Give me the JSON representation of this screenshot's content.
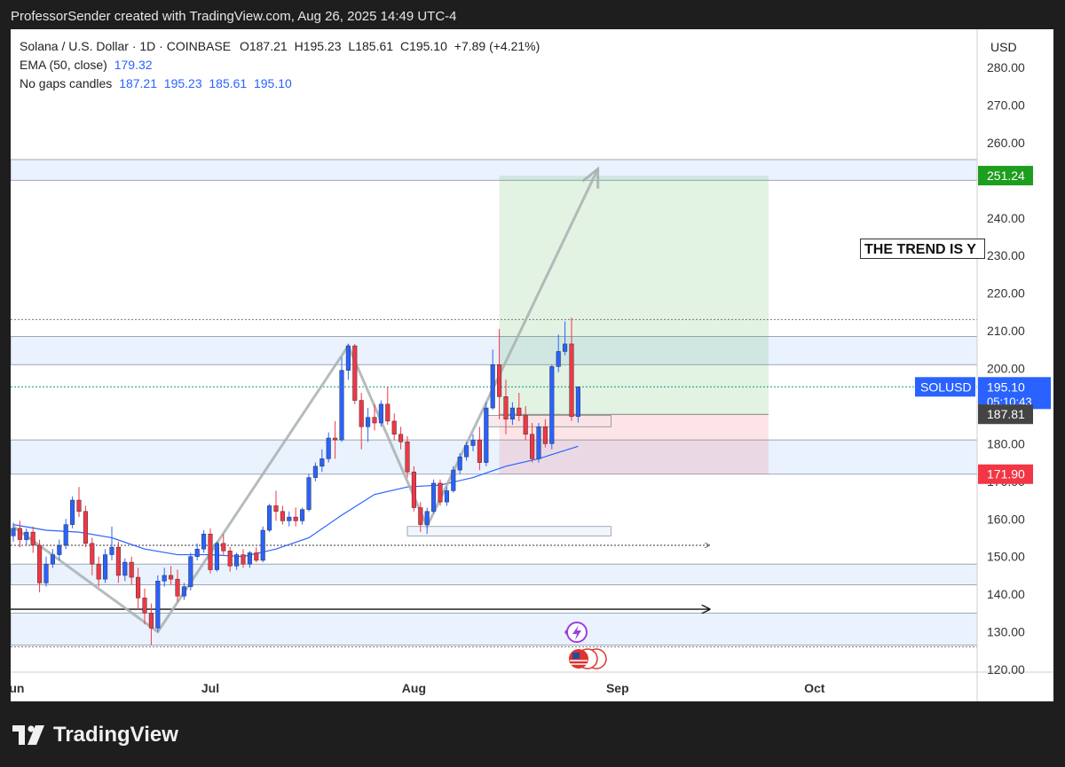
{
  "header": {
    "text": "ProfessorSender created with TradingView.com, Aug 26, 2025 14:49 UTC-4"
  },
  "legend": {
    "symbol": "Solana / U.S. Dollar · 1D · COINBASE",
    "o_label": "O",
    "o": "187.21",
    "h_label": "H",
    "h": "195.23",
    "l_label": "L",
    "l": "185.61",
    "c_label": "C",
    "c": "195.10",
    "change": "+7.89 (+4.21%)",
    "ema_label": "EMA (50, close)",
    "ema_value": "179.32",
    "candles_label": "No gaps candles",
    "candles_values": "187.21  195.23  185.61  195.10"
  },
  "currency": "USD",
  "annotation": "THE TREND IS Y",
  "brand": {
    "name": "TradingView"
  },
  "colors": {
    "up": "#2962ff",
    "down": "#f23645",
    "ema": "#2962ff",
    "target": "#089981",
    "stop": "#f23645",
    "zone": "#e3eefc"
  },
  "chart_data": {
    "type": "candlestick",
    "symbol": "SOLUSD",
    "y_ticks": [
      "120.00",
      "130.00",
      "140.00",
      "150.00",
      "160.00",
      "170.00",
      "180.00",
      "190.00",
      "200.00",
      "210.00",
      "220.00",
      "230.00",
      "240.00",
      "250.00",
      "260.00",
      "270.00",
      "280.00"
    ],
    "y_tick_values": [
      120,
      130,
      140,
      150,
      160,
      170,
      180,
      190,
      200,
      210,
      220,
      230,
      240,
      250,
      260,
      270,
      280
    ],
    "ylim": [
      120,
      282
    ],
    "x_ticks": [
      {
        "label": "Jun",
        "date": "2025-06-01"
      },
      {
        "label": "Jul",
        "date": "2025-07-01"
      },
      {
        "label": "Aug",
        "date": "2025-08-01"
      },
      {
        "label": "Sep",
        "date": "2025-09-01"
      },
      {
        "label": "Oct",
        "date": "2025-10-01"
      }
    ],
    "xlim": [
      "2025-06-01",
      "2025-10-20"
    ],
    "price_labels": [
      {
        "label": "251.24",
        "value": 251.24,
        "color": "#1e9e1e"
      },
      {
        "label": "195.10",
        "sub": "05:10:43",
        "tag": "SOLUSD",
        "value": 195.1,
        "color": "#2962ff"
      },
      {
        "label": "187.81",
        "value": 187.81,
        "color": "#444444"
      },
      {
        "label": "171.90",
        "value": 171.9,
        "color": "#f23645"
      }
    ],
    "candles": [
      {
        "date": "2025-06-01",
        "o": 155.5,
        "h": 159.0,
        "l": 154.0,
        "c": 157.5
      },
      {
        "date": "2025-06-02",
        "o": 157.5,
        "h": 159.5,
        "l": 152.5,
        "c": 154.5
      },
      {
        "date": "2025-06-03",
        "o": 154.5,
        "h": 157.5,
        "l": 153.0,
        "c": 156.5
      },
      {
        "date": "2025-06-04",
        "o": 156.5,
        "h": 158.0,
        "l": 151.0,
        "c": 153.0
      },
      {
        "date": "2025-06-05",
        "o": 153.0,
        "h": 154.5,
        "l": 140.5,
        "c": 143.0
      },
      {
        "date": "2025-06-06",
        "o": 143.0,
        "h": 150.0,
        "l": 142.0,
        "c": 148.0
      },
      {
        "date": "2025-06-07",
        "o": 148.0,
        "h": 152.0,
        "l": 147.0,
        "c": 150.5
      },
      {
        "date": "2025-06-08",
        "o": 150.5,
        "h": 154.5,
        "l": 149.0,
        "c": 153.0
      },
      {
        "date": "2025-06-09",
        "o": 153.0,
        "h": 160.0,
        "l": 152.0,
        "c": 158.5
      },
      {
        "date": "2025-06-10",
        "o": 158.5,
        "h": 166.0,
        "l": 157.5,
        "c": 165.0
      },
      {
        "date": "2025-06-11",
        "o": 165.0,
        "h": 168.5,
        "l": 160.5,
        "c": 162.0
      },
      {
        "date": "2025-06-12",
        "o": 162.0,
        "h": 163.5,
        "l": 152.5,
        "c": 153.5
      },
      {
        "date": "2025-06-13",
        "o": 153.5,
        "h": 155.0,
        "l": 145.0,
        "c": 148.0
      },
      {
        "date": "2025-06-14",
        "o": 148.0,
        "h": 150.0,
        "l": 142.0,
        "c": 144.0
      },
      {
        "date": "2025-06-15",
        "o": 144.0,
        "h": 152.0,
        "l": 143.0,
        "c": 150.5
      },
      {
        "date": "2025-06-16",
        "o": 150.5,
        "h": 158.0,
        "l": 149.0,
        "c": 152.5
      },
      {
        "date": "2025-06-17",
        "o": 152.5,
        "h": 154.0,
        "l": 143.0,
        "c": 145.0
      },
      {
        "date": "2025-06-18",
        "o": 145.0,
        "h": 149.5,
        "l": 143.5,
        "c": 148.5
      },
      {
        "date": "2025-06-19",
        "o": 148.5,
        "h": 150.0,
        "l": 142.5,
        "c": 144.5
      },
      {
        "date": "2025-06-20",
        "o": 144.5,
        "h": 147.0,
        "l": 136.0,
        "c": 139.0
      },
      {
        "date": "2025-06-21",
        "o": 139.0,
        "h": 141.5,
        "l": 132.0,
        "c": 135.0
      },
      {
        "date": "2025-06-22",
        "o": 135.0,
        "h": 137.5,
        "l": 126.5,
        "c": 131.0
      },
      {
        "date": "2025-06-23",
        "o": 131.0,
        "h": 145.0,
        "l": 130.0,
        "c": 143.5
      },
      {
        "date": "2025-06-24",
        "o": 143.5,
        "h": 147.0,
        "l": 142.0,
        "c": 145.0
      },
      {
        "date": "2025-06-25",
        "o": 145.0,
        "h": 147.5,
        "l": 142.5,
        "c": 144.0
      },
      {
        "date": "2025-06-26",
        "o": 144.0,
        "h": 146.5,
        "l": 138.0,
        "c": 139.5
      },
      {
        "date": "2025-06-27",
        "o": 139.5,
        "h": 143.0,
        "l": 138.5,
        "c": 142.0
      },
      {
        "date": "2025-06-28",
        "o": 142.0,
        "h": 151.0,
        "l": 141.0,
        "c": 150.0
      },
      {
        "date": "2025-06-29",
        "o": 150.0,
        "h": 153.5,
        "l": 149.0,
        "c": 152.0
      },
      {
        "date": "2025-06-30",
        "o": 152.0,
        "h": 157.0,
        "l": 151.0,
        "c": 156.0
      },
      {
        "date": "2025-07-01",
        "o": 156.0,
        "h": 157.5,
        "l": 145.5,
        "c": 146.5
      },
      {
        "date": "2025-07-02",
        "o": 146.5,
        "h": 154.0,
        "l": 146.0,
        "c": 153.5
      },
      {
        "date": "2025-07-03",
        "o": 153.5,
        "h": 156.0,
        "l": 150.5,
        "c": 151.5
      },
      {
        "date": "2025-07-04",
        "o": 151.5,
        "h": 152.5,
        "l": 146.0,
        "c": 147.5
      },
      {
        "date": "2025-07-05",
        "o": 147.5,
        "h": 151.0,
        "l": 146.5,
        "c": 150.5
      },
      {
        "date": "2025-07-06",
        "o": 150.5,
        "h": 152.0,
        "l": 147.0,
        "c": 148.0
      },
      {
        "date": "2025-07-07",
        "o": 148.0,
        "h": 151.5,
        "l": 147.0,
        "c": 151.0
      },
      {
        "date": "2025-07-08",
        "o": 151.0,
        "h": 152.5,
        "l": 148.5,
        "c": 149.0
      },
      {
        "date": "2025-07-09",
        "o": 149.0,
        "h": 158.0,
        "l": 148.5,
        "c": 157.0
      },
      {
        "date": "2025-07-10",
        "o": 157.0,
        "h": 164.0,
        "l": 156.5,
        "c": 163.5
      },
      {
        "date": "2025-07-11",
        "o": 163.5,
        "h": 167.5,
        "l": 159.5,
        "c": 162.0
      },
      {
        "date": "2025-07-12",
        "o": 162.0,
        "h": 163.5,
        "l": 158.5,
        "c": 159.5
      },
      {
        "date": "2025-07-13",
        "o": 159.5,
        "h": 162.0,
        "l": 158.0,
        "c": 160.5
      },
      {
        "date": "2025-07-14",
        "o": 160.5,
        "h": 163.0,
        "l": 158.0,
        "c": 159.5
      },
      {
        "date": "2025-07-15",
        "o": 159.5,
        "h": 163.0,
        "l": 158.5,
        "c": 162.5
      },
      {
        "date": "2025-07-16",
        "o": 162.5,
        "h": 172.0,
        "l": 162.0,
        "c": 171.0
      },
      {
        "date": "2025-07-17",
        "o": 171.0,
        "h": 175.0,
        "l": 170.0,
        "c": 174.0
      },
      {
        "date": "2025-07-18",
        "o": 174.0,
        "h": 178.5,
        "l": 172.5,
        "c": 176.0
      },
      {
        "date": "2025-07-19",
        "o": 176.0,
        "h": 183.0,
        "l": 175.0,
        "c": 181.5
      },
      {
        "date": "2025-07-20",
        "o": 181.5,
        "h": 186.0,
        "l": 176.0,
        "c": 181.0
      },
      {
        "date": "2025-07-21",
        "o": 181.0,
        "h": 203.0,
        "l": 180.5,
        "c": 199.5
      },
      {
        "date": "2025-07-22",
        "o": 199.5,
        "h": 206.5,
        "l": 197.0,
        "c": 206.0
      },
      {
        "date": "2025-07-23",
        "o": 206.0,
        "h": 206.5,
        "l": 190.5,
        "c": 191.5
      },
      {
        "date": "2025-07-24",
        "o": 191.5,
        "h": 193.5,
        "l": 178.5,
        "c": 184.5
      },
      {
        "date": "2025-07-25",
        "o": 184.5,
        "h": 189.5,
        "l": 180.5,
        "c": 187.0
      },
      {
        "date": "2025-07-26",
        "o": 187.0,
        "h": 190.5,
        "l": 183.5,
        "c": 185.5
      },
      {
        "date": "2025-07-27",
        "o": 185.5,
        "h": 191.5,
        "l": 184.5,
        "c": 190.5
      },
      {
        "date": "2025-07-28",
        "o": 190.5,
        "h": 195.0,
        "l": 185.0,
        "c": 186.0
      },
      {
        "date": "2025-07-29",
        "o": 186.0,
        "h": 188.0,
        "l": 181.0,
        "c": 182.5
      },
      {
        "date": "2025-07-30",
        "o": 182.5,
        "h": 184.5,
        "l": 178.5,
        "c": 180.5
      },
      {
        "date": "2025-07-31",
        "o": 180.5,
        "h": 182.0,
        "l": 171.0,
        "c": 172.5
      },
      {
        "date": "2025-08-01",
        "o": 172.5,
        "h": 174.0,
        "l": 162.0,
        "c": 163.0
      },
      {
        "date": "2025-08-02",
        "o": 163.0,
        "h": 164.5,
        "l": 156.5,
        "c": 158.5
      },
      {
        "date": "2025-08-03",
        "o": 158.5,
        "h": 163.0,
        "l": 156.0,
        "c": 162.0
      },
      {
        "date": "2025-08-04",
        "o": 162.0,
        "h": 170.5,
        "l": 161.5,
        "c": 169.5
      },
      {
        "date": "2025-08-05",
        "o": 169.5,
        "h": 170.5,
        "l": 163.5,
        "c": 164.5
      },
      {
        "date": "2025-08-06",
        "o": 164.5,
        "h": 168.5,
        "l": 163.5,
        "c": 167.5
      },
      {
        "date": "2025-08-07",
        "o": 167.5,
        "h": 174.0,
        "l": 167.0,
        "c": 173.0
      },
      {
        "date": "2025-08-08",
        "o": 173.0,
        "h": 177.5,
        "l": 172.0,
        "c": 176.5
      },
      {
        "date": "2025-08-09",
        "o": 176.5,
        "h": 180.5,
        "l": 175.5,
        "c": 179.5
      },
      {
        "date": "2025-08-10",
        "o": 179.5,
        "h": 182.5,
        "l": 178.0,
        "c": 181.0
      },
      {
        "date": "2025-08-11",
        "o": 181.0,
        "h": 184.5,
        "l": 173.0,
        "c": 175.0
      },
      {
        "date": "2025-08-12",
        "o": 175.0,
        "h": 191.0,
        "l": 174.0,
        "c": 189.5
      },
      {
        "date": "2025-08-13",
        "o": 189.5,
        "h": 205.0,
        "l": 189.0,
        "c": 201.0
      },
      {
        "date": "2025-08-14",
        "o": 201.0,
        "h": 210.5,
        "l": 186.5,
        "c": 192.5
      },
      {
        "date": "2025-08-15",
        "o": 192.5,
        "h": 197.0,
        "l": 182.5,
        "c": 186.5
      },
      {
        "date": "2025-08-16",
        "o": 186.5,
        "h": 191.0,
        "l": 185.0,
        "c": 189.5
      },
      {
        "date": "2025-08-17",
        "o": 189.5,
        "h": 193.5,
        "l": 186.0,
        "c": 187.5
      },
      {
        "date": "2025-08-18",
        "o": 187.5,
        "h": 190.0,
        "l": 181.0,
        "c": 182.5
      },
      {
        "date": "2025-08-19",
        "o": 182.5,
        "h": 185.5,
        "l": 175.0,
        "c": 176.0
      },
      {
        "date": "2025-08-20",
        "o": 176.0,
        "h": 185.5,
        "l": 175.0,
        "c": 184.5
      },
      {
        "date": "2025-08-21",
        "o": 184.5,
        "h": 186.5,
        "l": 179.0,
        "c": 180.0
      },
      {
        "date": "2025-08-22",
        "o": 180.0,
        "h": 201.0,
        "l": 178.5,
        "c": 200.5
      },
      {
        "date": "2025-08-23",
        "o": 200.5,
        "h": 209.0,
        "l": 199.0,
        "c": 204.5
      },
      {
        "date": "2025-08-24",
        "o": 204.5,
        "h": 212.5,
        "l": 203.5,
        "c": 206.5
      },
      {
        "date": "2025-08-25",
        "o": 206.5,
        "h": 213.5,
        "l": 186.0,
        "c": 187.2
      },
      {
        "date": "2025-08-26",
        "o": 187.21,
        "h": 195.23,
        "l": 185.61,
        "c": 195.1
      }
    ],
    "ema": [
      {
        "date": "2025-06-01",
        "v": 158.5
      },
      {
        "date": "2025-06-06",
        "v": 157.0
      },
      {
        "date": "2025-06-11",
        "v": 156.5
      },
      {
        "date": "2025-06-16",
        "v": 155.0
      },
      {
        "date": "2025-06-21",
        "v": 152.0
      },
      {
        "date": "2025-06-26",
        "v": 150.5
      },
      {
        "date": "2025-07-01",
        "v": 150.5
      },
      {
        "date": "2025-07-06",
        "v": 150.0
      },
      {
        "date": "2025-07-11",
        "v": 152.0
      },
      {
        "date": "2025-07-16",
        "v": 155.0
      },
      {
        "date": "2025-07-21",
        "v": 161.0
      },
      {
        "date": "2025-07-26",
        "v": 166.5
      },
      {
        "date": "2025-07-31",
        "v": 168.5
      },
      {
        "date": "2025-08-05",
        "v": 169.0
      },
      {
        "date": "2025-08-10",
        "v": 171.0
      },
      {
        "date": "2025-08-15",
        "v": 174.0
      },
      {
        "date": "2025-08-20",
        "v": 176.0
      },
      {
        "date": "2025-08-26",
        "v": 179.32
      }
    ],
    "zones": [
      {
        "low": 250.0,
        "high": 255.5
      },
      {
        "low": 201.0,
        "high": 208.5
      },
      {
        "low": 171.9,
        "high": 181.0
      },
      {
        "low": 155.5,
        "high": 158.0,
        "start": "2025-07-31",
        "end": "2025-08-31"
      },
      {
        "low": 142.5,
        "high": 148.0
      },
      {
        "low": 126.5,
        "high": 135.0
      }
    ],
    "levels": [
      {
        "value": 213.0,
        "style": "dotted",
        "color": "#777777"
      },
      {
        "value": 195.1,
        "style": "dotted",
        "color": "#089981"
      },
      {
        "value": 126.0,
        "style": "dotted",
        "color": "#777777"
      },
      {
        "value": 153.0,
        "style": "dotted-arrow",
        "end": "2025-09-15",
        "color": "#333333"
      },
      {
        "value": 136.0,
        "style": "arrow",
        "end": "2025-09-15",
        "color": "#111111"
      }
    ],
    "position": {
      "start": "2025-08-14",
      "end": "2025-09-24",
      "entry": 187.81,
      "target": 251.24,
      "stop": 171.9
    },
    "pattern": [
      {
        "date": "2025-06-01",
        "v": 158.0
      },
      {
        "date": "2025-06-23",
        "v": 130.0
      },
      {
        "date": "2025-07-22",
        "v": 206.0
      },
      {
        "date": "2025-08-03",
        "v": 158.0
      },
      {
        "date": "2025-08-29",
        "v": 253.0
      }
    ],
    "small_box": {
      "start": "2025-08-12",
      "end": "2025-08-31",
      "low": 184.5,
      "high": 187.5
    }
  }
}
